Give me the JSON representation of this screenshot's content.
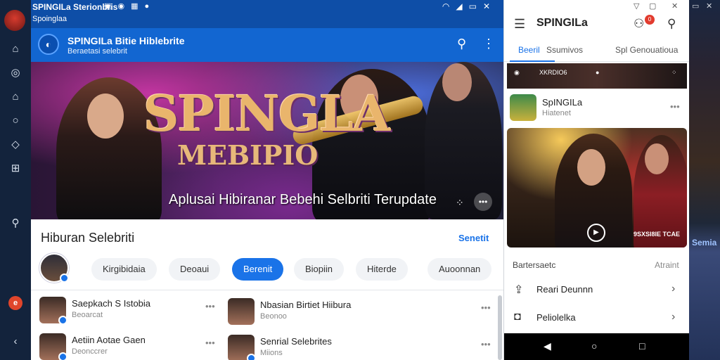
{
  "statusbar": {
    "title": "SPINGILa Sterionbris",
    "subtitle": "Spoinglaa",
    "system_icons": "▭ ▢ ✕"
  },
  "app": {
    "title": "SPINGILa  Bitie Hiblebrite",
    "subtitle": "Beraetasi selebrit",
    "logo_text": "◐"
  },
  "hero": {
    "title": "SPINGLA",
    "subtitle": "MEBIPIO",
    "caption": "Aplusai Hibiranar Bebehi Selbriti Terupdate"
  },
  "section": {
    "title": "Hiburan Selebriti",
    "link": "Senetit",
    "chips": [
      "Kirgibidaia",
      "Deoaui",
      "Berenit",
      "Biopiin",
      "Hiterde",
      "Auoonnan"
    ],
    "active_chip_index": 2
  },
  "list": [
    {
      "name": "Saepkach S Istobia",
      "sub": "Beoarcat"
    },
    {
      "name": "Nbasian Birtiet Hiibura",
      "sub": "Beonoo"
    },
    {
      "name": "Aetiin Aotae Gaen",
      "sub": "Deonccrer"
    },
    {
      "name": "Senrial Selebrites",
      "sub": "Miions"
    }
  ],
  "phone": {
    "title": "SPINGILa",
    "notif_count": "0",
    "tabs": [
      "Beeril",
      "Ssumivos",
      "Spl Genouatioua"
    ],
    "active_tab": 0,
    "strip_text": "XKRDIO6",
    "card_name": "SpINGILa",
    "card_sub": "Hiatenet",
    "photo_tag": "9SXSI8IE TCAE",
    "section_left": "Bartersaetc",
    "section_right": "Atraint",
    "rows": [
      "Reari Deunnn",
      "Peliolelka"
    ]
  },
  "right_strip": {
    "label": "Semia"
  },
  "colors": {
    "accent": "#1a73e8",
    "header_blue": "#1266d1",
    "status_blue": "#0e4ea7",
    "rail": "#13233c"
  }
}
